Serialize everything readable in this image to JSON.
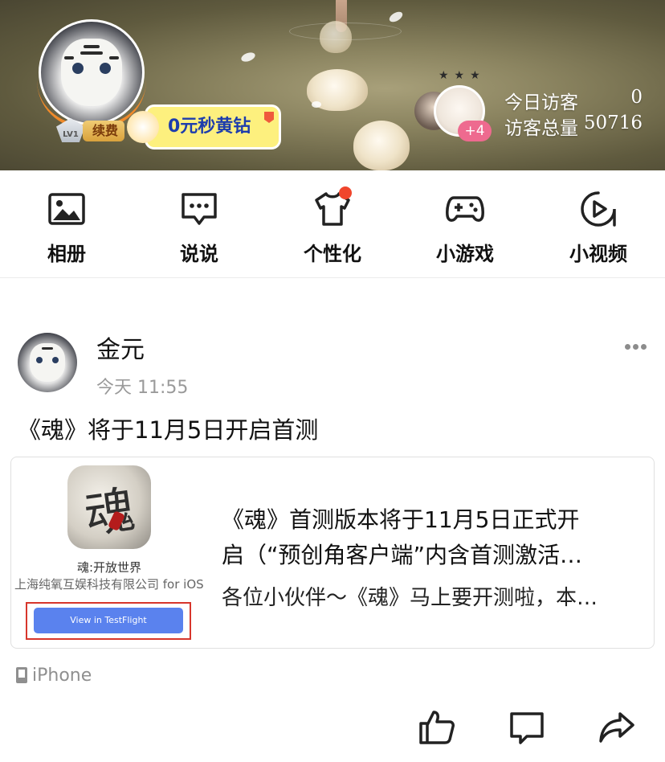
{
  "header": {
    "level_badge": "LV1",
    "renew_label": "续费",
    "promo_label": "0元秒黄钻",
    "visitor_plus": "+4",
    "stats": [
      {
        "label": "今日访客",
        "value": "0"
      },
      {
        "label": "访客总量",
        "value": "50716"
      }
    ]
  },
  "nav": {
    "items": [
      {
        "label": "相册",
        "icon": "photo-album-icon"
      },
      {
        "label": "说说",
        "icon": "message-bubble-icon"
      },
      {
        "label": "个性化",
        "icon": "tshirt-icon",
        "has_dot": true
      },
      {
        "label": "小游戏",
        "icon": "gamepad-icon"
      },
      {
        "label": "小视频",
        "icon": "play-circle-icon"
      }
    ]
  },
  "post": {
    "author": "金元",
    "time": "今天 11:55",
    "text": "《魂》将于11月5日开启首测",
    "card": {
      "app_icon_glyph": "魂",
      "app_name": "魂:开放世界",
      "company": "上海纯氧互娱科技有限公司 for iOS",
      "button_label": "View in TestFlight",
      "title_line1": "《魂》首测版本将于11月5日正式开",
      "title_line2": "启（“预创角客户端”内含首测激活…",
      "description": "各位小伙伴～《魂》马上要开测啦，本…"
    },
    "device": "iPhone",
    "actions": [
      "like-icon",
      "comment-icon",
      "share-icon"
    ]
  },
  "colors": {
    "promo_bg": "#fdf07e",
    "promo_text": "#1d3dad",
    "notify_dot": "#f0452c",
    "testflight_button": "#5a82ee",
    "highlight_frame": "#d7362c"
  }
}
